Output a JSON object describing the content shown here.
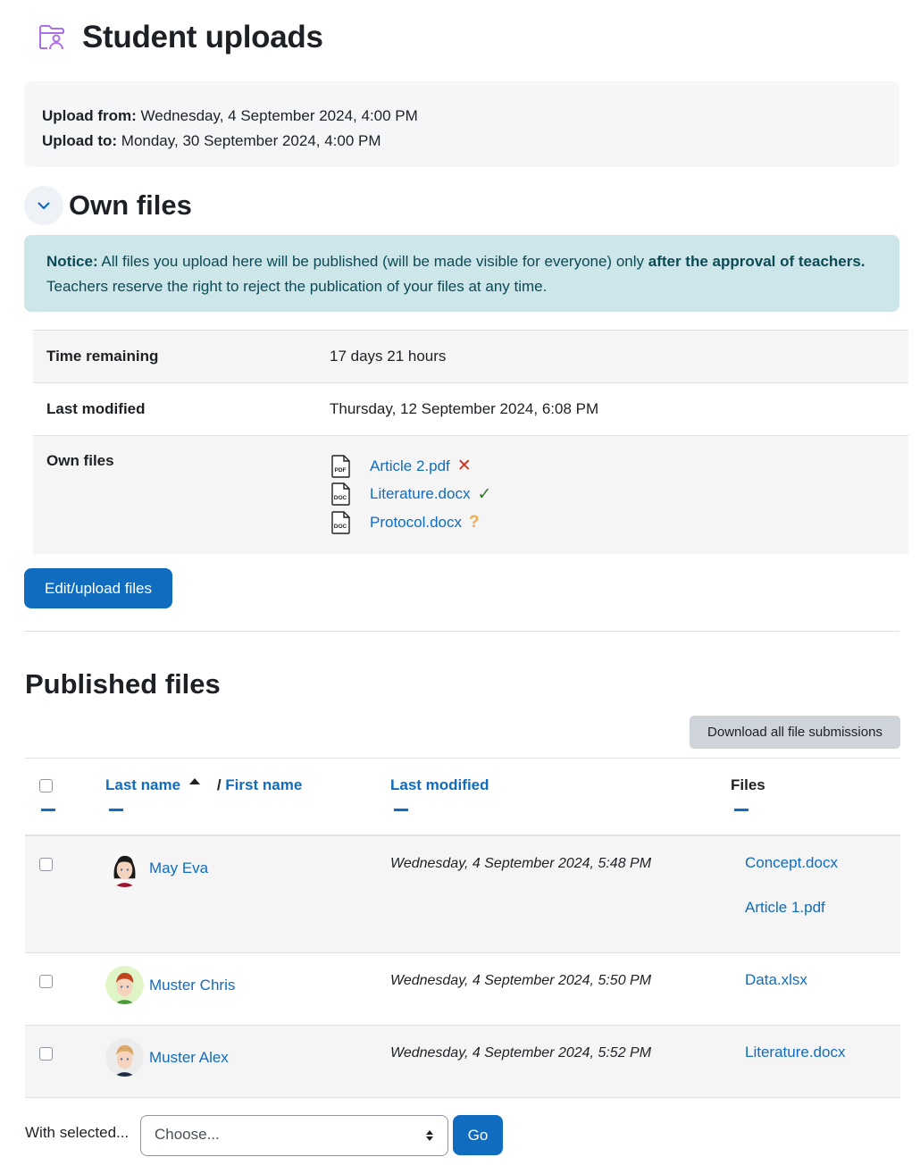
{
  "header": {
    "title": "Student uploads",
    "icon": "folder-user-icon"
  },
  "dates": {
    "from_label": "Upload from:",
    "from_value": "Wednesday, 4 September 2024, 4:00 PM",
    "to_label": "Upload to:",
    "to_value": "Monday, 30 September 2024, 4:00 PM"
  },
  "own_files": {
    "title": "Own files",
    "notice": {
      "label": "Notice:",
      "text1": " All files you upload here will be published (will be made visible for everyone) only ",
      "bold": "after the approval of teachers.",
      "text2": " Teachers reserve the right to reject the publication of your files at any time."
    },
    "status": {
      "time_remaining_label": "Time remaining",
      "time_remaining_value": "17 days 21 hours",
      "last_modified_label": "Last modified",
      "last_modified_value": "Thursday, 12 September 2024, 6:08 PM",
      "own_files_label": "Own files",
      "files": [
        {
          "type": "PDF",
          "name": "Article 2.pdf",
          "status": "rejected",
          "status_glyph": "✕",
          "status_color": "#ca3120"
        },
        {
          "type": "DOC",
          "name": "Literature.docx",
          "status": "approved",
          "status_glyph": "✓",
          "status_color": "#357a32"
        },
        {
          "type": "DOC",
          "name": "Protocol.docx",
          "status": "pending",
          "status_glyph": "?",
          "status_color": "#f0ad4e"
        }
      ]
    },
    "edit_button": "Edit/upload files"
  },
  "published": {
    "title": "Published files",
    "download_button": "Download all file submissions",
    "columns": {
      "last_name": "Last name",
      "separator": "/",
      "first_name": "First name",
      "last_modified": "Last modified",
      "files": "Files"
    },
    "rows": [
      {
        "name": "May Eva",
        "modified": "Wednesday, 4 September 2024, 5:48 PM",
        "files": [
          "Concept.docx",
          "Article 1.pdf"
        ]
      },
      {
        "name": "Muster Chris",
        "modified": "Wednesday, 4 September 2024, 5:50 PM",
        "files": [
          "Data.xlsx"
        ]
      },
      {
        "name": "Muster Alex",
        "modified": "Wednesday, 4 September 2024, 5:52 PM",
        "files": [
          "Literature.docx"
        ]
      }
    ]
  },
  "bulk": {
    "label": "With selected...",
    "select_value": "Choose...",
    "go_button": "Go"
  },
  "colors": {
    "accent": "#0f6cbf",
    "notice_bg": "#cde6ea",
    "icon_purple": "#a96fe8"
  }
}
